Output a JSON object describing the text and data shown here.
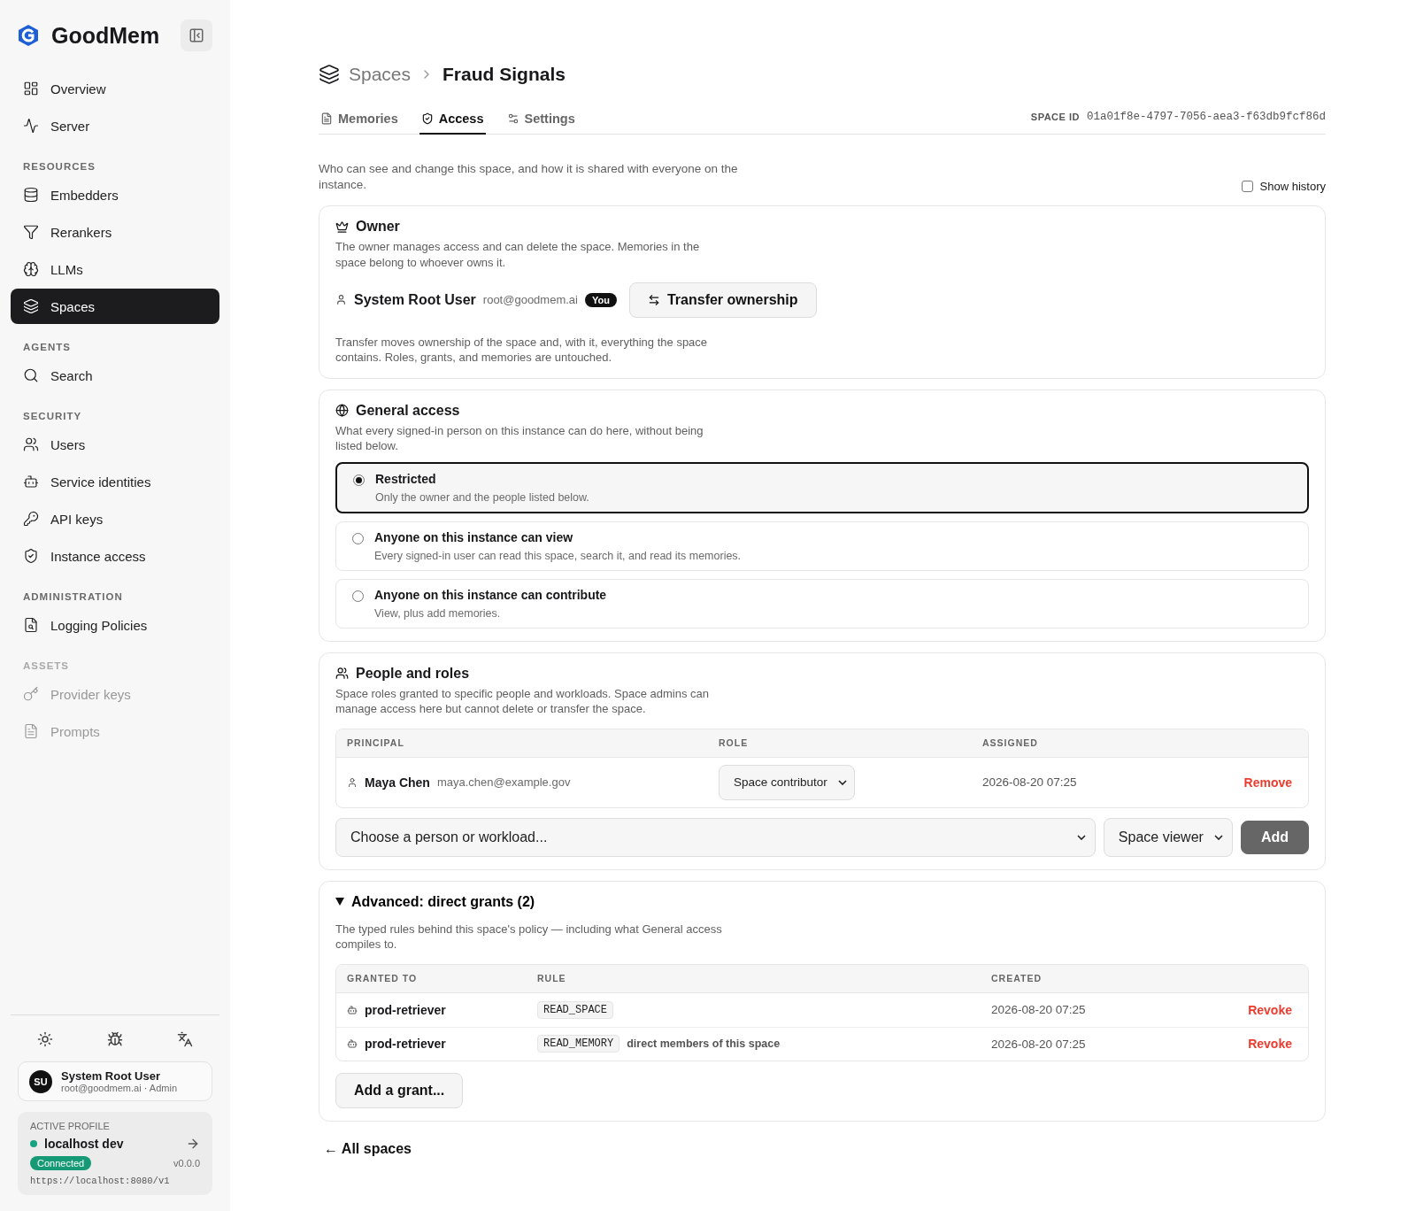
{
  "sidebar": {
    "brand": "GoodMem",
    "sections": [
      {
        "items": [
          {
            "label": "Overview",
            "selected": false,
            "disabled": false
          },
          {
            "label": "Server",
            "selected": false,
            "disabled": false
          }
        ]
      },
      {
        "title": "RESOURCES",
        "items": [
          {
            "label": "Embedders",
            "selected": false,
            "disabled": false
          },
          {
            "label": "Rerankers",
            "selected": false,
            "disabled": false
          },
          {
            "label": "LLMs",
            "selected": false,
            "disabled": false
          },
          {
            "label": "Spaces",
            "selected": true,
            "disabled": false
          }
        ]
      },
      {
        "title": "AGENTS",
        "items": [
          {
            "label": "Search",
            "selected": false,
            "disabled": false
          }
        ]
      },
      {
        "title": "SECURITY",
        "items": [
          {
            "label": "Users",
            "selected": false,
            "disabled": false
          },
          {
            "label": "Service identities",
            "selected": false,
            "disabled": false
          },
          {
            "label": "API keys",
            "selected": false,
            "disabled": false
          },
          {
            "label": "Instance access",
            "selected": false,
            "disabled": false
          }
        ]
      },
      {
        "title": "ADMINISTRATION",
        "items": [
          {
            "label": "Logging Policies",
            "selected": false,
            "disabled": false
          }
        ]
      },
      {
        "title": "ASSETS",
        "items": [
          {
            "label": "Provider keys",
            "selected": false,
            "disabled": true
          },
          {
            "label": "Prompts",
            "selected": false,
            "disabled": true
          }
        ]
      }
    ],
    "user": {
      "initials": "SU",
      "name": "System Root User",
      "detail": "root@goodmem.ai · Admin"
    },
    "profile": {
      "label": "ACTIVE PROFILE",
      "name": "localhost dev",
      "status": "Connected",
      "version": "v0.0.0",
      "url": "https://localhost:8080/v1"
    }
  },
  "breadcrumb": {
    "parent": "Spaces",
    "current": "Fraud Signals"
  },
  "tabs": [
    {
      "label": "Memories",
      "selected": false
    },
    {
      "label": "Access",
      "selected": true
    },
    {
      "label": "Settings",
      "selected": false
    }
  ],
  "space_id": {
    "label": "SPACE ID",
    "value": "01a01f8e-4797-7056-aea3-f63db9fcf86d"
  },
  "intro": "Who can see and change this space, and how it is shared with everyone on the instance.",
  "show_history": {
    "label": "Show history",
    "checked": false
  },
  "owner": {
    "title": "Owner",
    "description": "The owner manages access and can delete the space. Memories in the space belong to whoever owns it.",
    "name": "System Root User",
    "email": "root@goodmem.ai",
    "badge": "You",
    "button": "Transfer ownership",
    "note": "Transfer moves ownership of the space and, with it, everything the space contains. Roles, grants, and memories are untouched."
  },
  "general_access": {
    "title": "General access",
    "description": "What every signed-in person on this instance can do here, without being listed below.",
    "options": [
      {
        "label": "Restricted",
        "description": "Only the owner and the people listed below.",
        "selected": true
      },
      {
        "label": "Anyone on this instance can view",
        "description": "Every signed-in user can read this space, search it, and read its memories.",
        "selected": false
      },
      {
        "label": "Anyone on this instance can contribute",
        "description": "View, plus add memories.",
        "selected": false
      }
    ]
  },
  "people": {
    "title": "People and roles",
    "description": "Space roles granted to specific people and workloads. Space admins can manage access here but cannot delete or transfer the space.",
    "columns": [
      "PRINCIPAL",
      "ROLE",
      "ASSIGNED"
    ],
    "rows": [
      {
        "name": "Maya Chen",
        "email": "maya.chen@example.gov",
        "role": "Space contributor",
        "assigned": "2026-08-20 07:25",
        "action": "Remove"
      }
    ],
    "add": {
      "principal_placeholder": "Choose a person or workload...",
      "role": "Space viewer",
      "button": "Add"
    }
  },
  "advanced": {
    "title": "Advanced: direct grants (2)",
    "expanded": true,
    "description": "The typed rules behind this space's policy — including what General access compiles to.",
    "columns": [
      "GRANTED TO",
      "RULE",
      "CREATED"
    ],
    "rows": [
      {
        "granted_to": "prod-retriever",
        "rule": "READ_SPACE",
        "scope": null,
        "created": "2026-08-20 07:25",
        "action": "Revoke"
      },
      {
        "granted_to": "prod-retriever",
        "rule": "READ_MEMORY",
        "scope": "direct members of this space",
        "created": "2026-08-20 07:25",
        "action": "Revoke"
      }
    ],
    "button": "Add a grant..."
  },
  "back_link": "← All spaces"
}
